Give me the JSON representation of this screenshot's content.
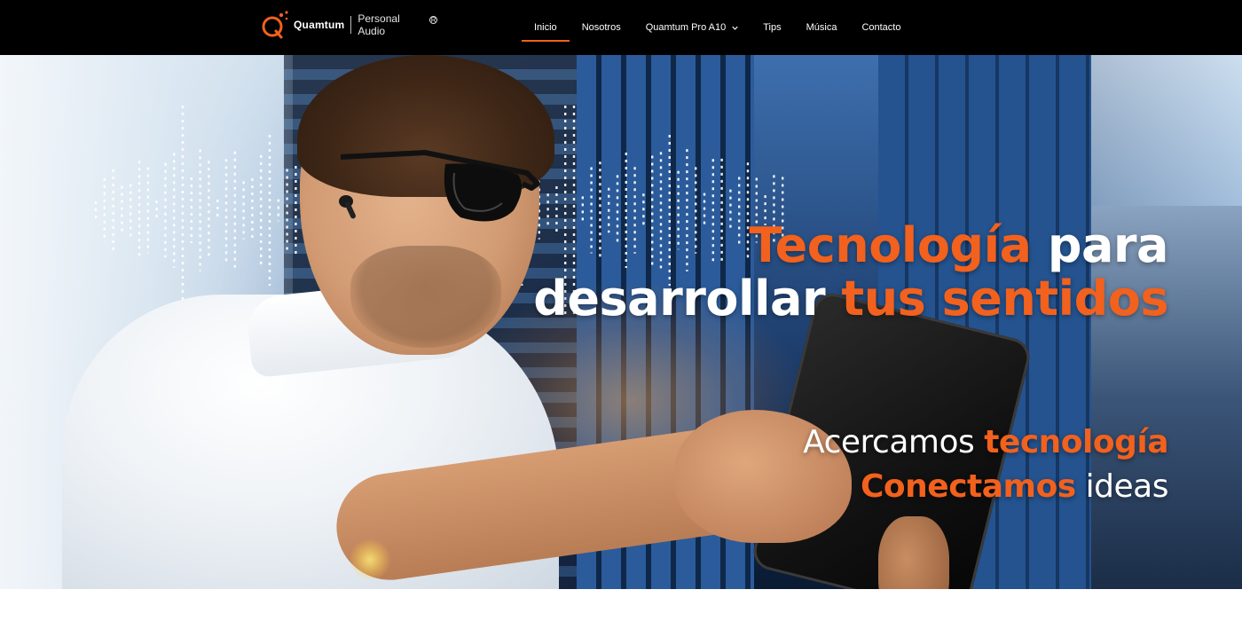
{
  "brand": {
    "name": "Quamtum",
    "subtitle": "Personal Audio",
    "registered_mark": "R",
    "accent_color": "#f2611d"
  },
  "nav": {
    "items": [
      {
        "label": "Inicio",
        "active": true
      },
      {
        "label": "Nosotros",
        "active": false
      },
      {
        "label": "Quamtum Pro A10",
        "active": false,
        "has_dropdown": true
      },
      {
        "label": "Tips",
        "active": false
      },
      {
        "label": "Música",
        "active": false
      },
      {
        "label": "Contacto",
        "active": false
      }
    ],
    "dropdown_icon": "chevron-down-icon"
  },
  "hero": {
    "headline": {
      "line1_highlight": "Tecnología",
      "line1_rest": " para",
      "line2_rest": "desarrollar ",
      "line2_highlight": "tus sentidos"
    },
    "tagline": {
      "line1_plain": "Acercamos ",
      "line1_highlight": "tecnología",
      "line2_highlight": "Conectamos",
      "line2_plain": " ideas"
    }
  }
}
